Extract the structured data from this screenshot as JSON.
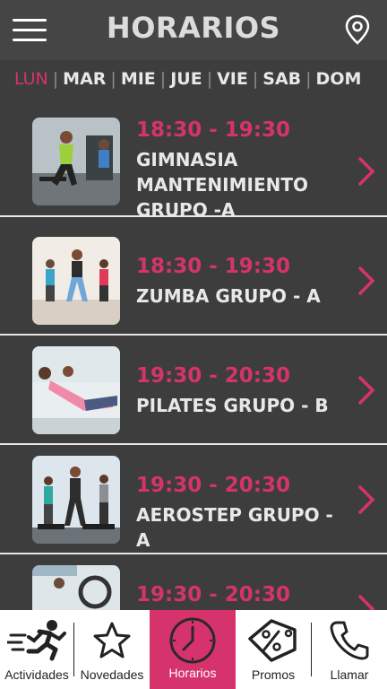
{
  "header": {
    "title": "HORARIOS",
    "menu_icon": "hamburger-menu-icon",
    "location_icon": "location-pin-icon"
  },
  "days": [
    {
      "label": "LUN",
      "active": true
    },
    {
      "label": "MAR",
      "active": false
    },
    {
      "label": "MIE",
      "active": false
    },
    {
      "label": "JUE",
      "active": false
    },
    {
      "label": "VIE",
      "active": false
    },
    {
      "label": "SAB",
      "active": false
    },
    {
      "label": "DOM",
      "active": false
    }
  ],
  "classes": [
    {
      "time": "18:30 - 19:30",
      "name": "GIMNASIA MANTENIMIENTO GRUPO -A"
    },
    {
      "time": "18:30 - 19:30",
      "name": "ZUMBA GRUPO - A"
    },
    {
      "time": "19:30 - 20:30",
      "name": "PILATES GRUPO - B"
    },
    {
      "time": "19:30 - 20:30",
      "name": "AEROSTEP GRUPO - A"
    },
    {
      "time": "19:30 - 20:30",
      "name": ""
    }
  ],
  "tabs": [
    {
      "label": "Actividades",
      "icon": "running-icon",
      "active": false
    },
    {
      "label": "Novedades",
      "icon": "star-icon",
      "active": false
    },
    {
      "label": "Horarios",
      "icon": "clock-icon",
      "active": true
    },
    {
      "label": "Promos",
      "icon": "percent-tag-icon",
      "active": false
    },
    {
      "label": "Llamar",
      "icon": "phone-icon",
      "active": false
    }
  ],
  "colors": {
    "accent": "#d6336c",
    "background": "#3d3d3d",
    "header": "#454545",
    "text": "#e8e8e8"
  }
}
